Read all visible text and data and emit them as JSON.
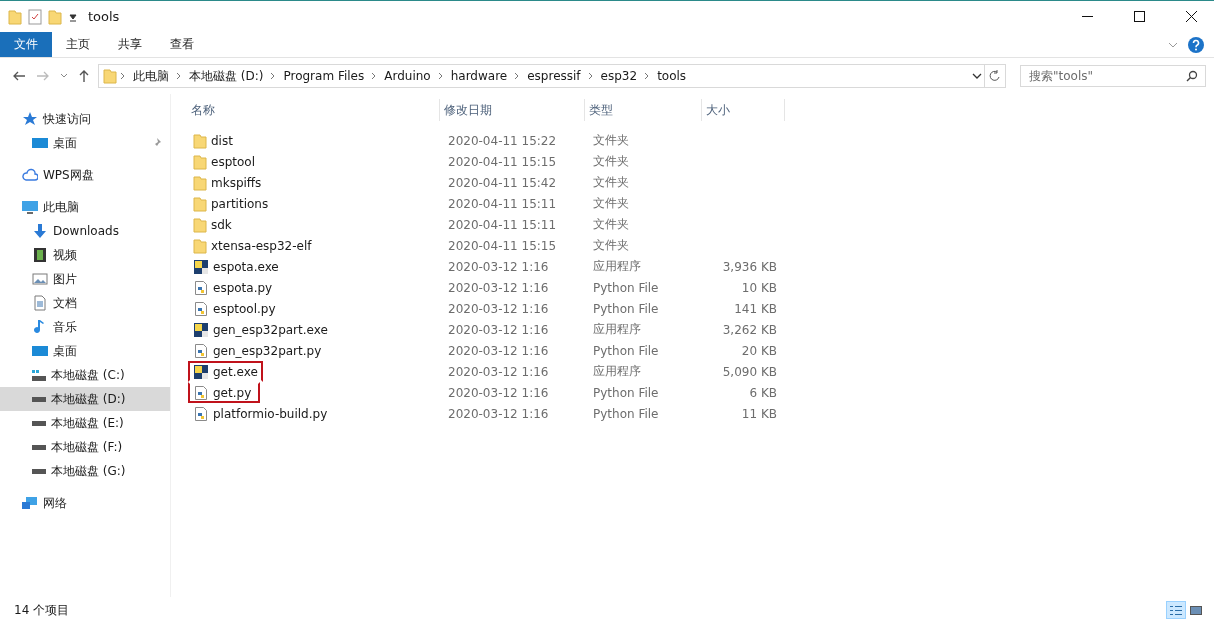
{
  "window": {
    "title": "tools"
  },
  "ribbon_tabs": [
    {
      "label": "文件",
      "kind": "file",
      "selected": false
    },
    {
      "label": "主页",
      "kind": "tab",
      "selected": false
    },
    {
      "label": "共享",
      "kind": "tab",
      "selected": false
    },
    {
      "label": "查看",
      "kind": "tab",
      "selected": false
    }
  ],
  "address": {
    "crumbs": [
      "此电脑",
      "本地磁盘 (D:)",
      "Program Files",
      "Arduino",
      "hardware",
      "espressif",
      "esp32",
      "tools"
    ]
  },
  "search": {
    "placeholder": "搜索\"tools\""
  },
  "sidebar": {
    "sections": [
      {
        "label": "快速访问",
        "kind": "star",
        "selected": false,
        "pinned": false,
        "children": [
          {
            "label": "桌面",
            "kind": "desktop",
            "selected": false,
            "pinned": true
          }
        ]
      },
      {
        "label": "WPS网盘",
        "kind": "cloud",
        "selected": false,
        "pinned": false
      },
      {
        "label": "此电脑",
        "kind": "pc",
        "selected": false,
        "pinned": false,
        "children": [
          {
            "label": "Downloads",
            "kind": "download",
            "selected": false,
            "pinned": false
          },
          {
            "label": "视频",
            "kind": "video",
            "selected": false,
            "pinned": false
          },
          {
            "label": "图片",
            "kind": "picture",
            "selected": false,
            "pinned": false
          },
          {
            "label": "文档",
            "kind": "document",
            "selected": false,
            "pinned": false
          },
          {
            "label": "音乐",
            "kind": "music",
            "selected": false,
            "pinned": false
          },
          {
            "label": "桌面",
            "kind": "desktop",
            "selected": false,
            "pinned": false
          },
          {
            "label": "本地磁盘 (C:)",
            "kind": "system-drive",
            "selected": false,
            "pinned": false
          },
          {
            "label": "本地磁盘 (D:)",
            "kind": "drive",
            "selected": true,
            "pinned": false
          },
          {
            "label": "本地磁盘 (E:)",
            "kind": "drive",
            "selected": false,
            "pinned": false
          },
          {
            "label": "本地磁盘 (F:)",
            "kind": "drive",
            "selected": false,
            "pinned": false
          },
          {
            "label": "本地磁盘 (G:)",
            "kind": "drive",
            "selected": false,
            "pinned": false
          }
        ]
      },
      {
        "label": "网络",
        "kind": "network",
        "selected": false,
        "pinned": false
      }
    ]
  },
  "table": {
    "columns": [
      "名称",
      "修改日期",
      "类型",
      "大小"
    ],
    "rows": [
      {
        "name": "dist",
        "kind": "folder",
        "date": "2020-04-11 15:22",
        "type": "文件夹",
        "highlighted": false
      },
      {
        "name": "esptool",
        "kind": "folder",
        "date": "2020-04-11 15:15",
        "type": "文件夹",
        "highlighted": false
      },
      {
        "name": "mkspiffs",
        "kind": "folder",
        "date": "2020-04-11 15:42",
        "type": "文件夹",
        "highlighted": false
      },
      {
        "name": "partitions",
        "kind": "folder",
        "date": "2020-04-11 15:11",
        "type": "文件夹",
        "highlighted": false
      },
      {
        "name": "sdk",
        "kind": "folder",
        "date": "2020-04-11 15:11",
        "type": "文件夹",
        "highlighted": false
      },
      {
        "name": "xtensa-esp32-elf",
        "kind": "folder",
        "date": "2020-04-11 15:15",
        "type": "文件夹",
        "highlighted": false
      },
      {
        "name": "espota.exe",
        "kind": "exe",
        "date": "2020-03-12 1:16",
        "type": "应用程序",
        "size": "3,936 KB",
        "highlighted": false
      },
      {
        "name": "espota.py",
        "kind": "py",
        "date": "2020-03-12 1:16",
        "type": "Python File",
        "size": "10 KB",
        "highlighted": false
      },
      {
        "name": "esptool.py",
        "kind": "py",
        "date": "2020-03-12 1:16",
        "type": "Python File",
        "size": "141 KB",
        "highlighted": false
      },
      {
        "name": "gen_esp32part.exe",
        "kind": "exe",
        "date": "2020-03-12 1:16",
        "type": "应用程序",
        "size": "3,262 KB",
        "highlighted": false
      },
      {
        "name": "gen_esp32part.py",
        "kind": "py",
        "date": "2020-03-12 1:16",
        "type": "Python File",
        "size": "20 KB",
        "highlighted": false
      },
      {
        "name": "get.exe",
        "kind": "exe",
        "date": "2020-03-12 1:16",
        "type": "应用程序",
        "size": "5,090 KB",
        "highlighted": true
      },
      {
        "name": "get.py",
        "kind": "py",
        "date": "2020-03-12 1:16",
        "type": "Python File",
        "size": "6 KB",
        "highlighted": true
      },
      {
        "name": "platformio-build.py",
        "kind": "py",
        "date": "2020-03-12 1:16",
        "type": "Python File",
        "size": "11 KB",
        "highlighted": false
      }
    ]
  },
  "status_bar": {
    "count": "14 个项目",
    "view_buttons": [
      {
        "kind": "details",
        "selected": true
      },
      {
        "kind": "thumbnails",
        "selected": false
      }
    ]
  }
}
